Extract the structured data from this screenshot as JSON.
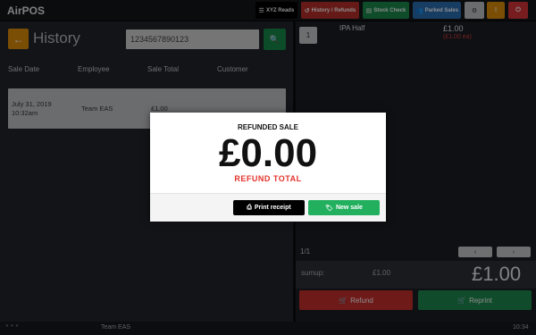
{
  "app": {
    "title": "AirPOS"
  },
  "toolbar": {
    "xyz_reads": "XYZ Reads",
    "history_refunds": "History / Refunds",
    "stock_check": "Stock Check",
    "parked_sales": "Parked Sales",
    "icons": [
      "menu-icon",
      "undo-icon",
      "clipboard-icon",
      "users-icon",
      "gear-icon",
      "alert-icon",
      "power-icon"
    ],
    "colors": {
      "xyz": "#000000",
      "history": "#c9302c",
      "stock": "#1a8a4d",
      "parked": "#2a6fb5",
      "settings": "#bfc1c5",
      "alert": "#e08e0b",
      "power": "#d9363a"
    }
  },
  "history": {
    "title": "History",
    "search_value": "1234567890123",
    "columns": [
      "Sale Date",
      "Employee",
      "Sale Total",
      "Customer"
    ],
    "rows": [
      {
        "date": "July 31, 2019",
        "time": "10:32am",
        "employee": "Team EAS",
        "total": "£1.00",
        "customer": ""
      }
    ]
  },
  "basket": {
    "items": [
      {
        "qty": "1",
        "name": "IPA Half",
        "price": "£1.00",
        "sub": "(£1.00 ea)"
      }
    ],
    "pager": "1/1",
    "pager_prev": "‹",
    "pager_next": "›",
    "sumup_label": "sumup:",
    "sumup_value": "£1.00",
    "total": "£1.00",
    "refund_label": "Refund",
    "reprint_label": "Reprint"
  },
  "footer": {
    "user": "Team EAS",
    "time": "10:34"
  },
  "modal": {
    "title": "REFUNDED SALE",
    "amount": "£0.00",
    "subtitle": "REFUND TOTAL",
    "print_label": "Print receipt",
    "new_sale_label": "New sale",
    "accent": "#e4332c"
  }
}
